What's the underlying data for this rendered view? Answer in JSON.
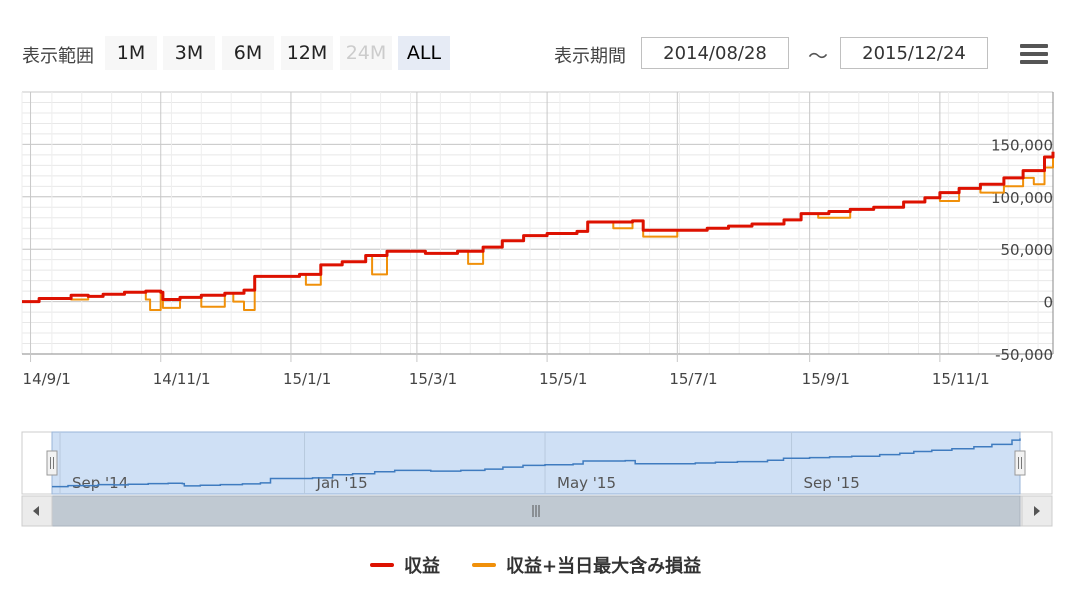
{
  "range_selector": {
    "label": "表示範囲",
    "buttons": [
      {
        "label": "1M",
        "state": "normal"
      },
      {
        "label": "3M",
        "state": "normal"
      },
      {
        "label": "6M",
        "state": "normal"
      },
      {
        "label": "12M",
        "state": "normal"
      },
      {
        "label": "24M",
        "state": "disabled"
      },
      {
        "label": "ALL",
        "state": "active"
      }
    ]
  },
  "date_range": {
    "label": "表示期間",
    "from": "2014/08/28",
    "separator": "～",
    "to": "2015/12/24"
  },
  "menu_icon": "hamburger-menu-icon",
  "colors": {
    "profit": "#dd1100",
    "profit_with_loss": "#f0900a",
    "navigator_fill": "#cfe0f5",
    "navigator_line": "#3f7bbf",
    "grid": "#dcdcdc"
  },
  "chart_data": {
    "type": "line",
    "title": "",
    "xlabel": "",
    "ylabel": "",
    "x_ticks": [
      "14/9/1",
      "14/11/1",
      "15/1/1",
      "15/3/1",
      "15/5/1",
      "15/7/1",
      "15/9/1",
      "15/11/1"
    ],
    "y_ticks": [
      "150,000",
      "100,000",
      "50,000",
      "0",
      "-50,000"
    ],
    "xlim": [
      "2014-08-28",
      "2015-12-24"
    ],
    "ylim": [
      -50000,
      200000
    ],
    "grid": true,
    "legend_position": "bottom",
    "series": [
      {
        "name": "収益",
        "color": "#dd1100",
        "points": [
          [
            "2014-08-28",
            0
          ],
          [
            "2014-09-05",
            3000
          ],
          [
            "2014-09-15",
            3000
          ],
          [
            "2014-09-20",
            6000
          ],
          [
            "2014-09-28",
            5000
          ],
          [
            "2014-10-05",
            7000
          ],
          [
            "2014-10-15",
            9000
          ],
          [
            "2014-10-25",
            10000
          ],
          [
            "2014-11-01",
            9000
          ],
          [
            "2014-11-02",
            2000
          ],
          [
            "2014-11-10",
            4000
          ],
          [
            "2014-11-20",
            6000
          ],
          [
            "2014-12-01",
            8000
          ],
          [
            "2014-12-10",
            11000
          ],
          [
            "2014-12-15",
            24000
          ],
          [
            "2014-12-25",
            24000
          ],
          [
            "2015-01-05",
            26000
          ],
          [
            "2015-01-15",
            35000
          ],
          [
            "2015-01-25",
            38000
          ],
          [
            "2015-02-05",
            44000
          ],
          [
            "2015-02-15",
            48000
          ],
          [
            "2015-02-25",
            48000
          ],
          [
            "2015-03-05",
            46000
          ],
          [
            "2015-03-20",
            48000
          ],
          [
            "2015-04-01",
            52000
          ],
          [
            "2015-04-10",
            58000
          ],
          [
            "2015-04-20",
            63000
          ],
          [
            "2015-05-01",
            65000
          ],
          [
            "2015-05-15",
            67000
          ],
          [
            "2015-05-20",
            76000
          ],
          [
            "2015-06-01",
            76000
          ],
          [
            "2015-06-10",
            77000
          ],
          [
            "2015-06-15",
            68000
          ],
          [
            "2015-07-01",
            68000
          ],
          [
            "2015-07-15",
            70000
          ],
          [
            "2015-07-25",
            72000
          ],
          [
            "2015-08-05",
            74000
          ],
          [
            "2015-08-20",
            78000
          ],
          [
            "2015-08-28",
            84000
          ],
          [
            "2015-09-10",
            86000
          ],
          [
            "2015-09-20",
            88000
          ],
          [
            "2015-10-01",
            90000
          ],
          [
            "2015-10-15",
            95000
          ],
          [
            "2015-10-25",
            99000
          ],
          [
            "2015-11-01",
            104000
          ],
          [
            "2015-11-10",
            108000
          ],
          [
            "2015-11-20",
            112000
          ],
          [
            "2015-12-01",
            118000
          ],
          [
            "2015-12-10",
            125000
          ],
          [
            "2015-12-20",
            138000
          ],
          [
            "2015-12-24",
            143000
          ]
        ]
      },
      {
        "name": "収益+当日最大含み損益",
        "color": "#f0900a",
        "points": [
          [
            "2014-08-28",
            0
          ],
          [
            "2014-09-05",
            3000
          ],
          [
            "2014-09-15",
            3000
          ],
          [
            "2014-09-20",
            2000
          ],
          [
            "2014-09-28",
            5000
          ],
          [
            "2014-10-05",
            7000
          ],
          [
            "2014-10-15",
            9000
          ],
          [
            "2014-10-25",
            2000
          ],
          [
            "2014-10-27",
            -8000
          ],
          [
            "2014-11-01",
            9000
          ],
          [
            "2014-11-02",
            -6000
          ],
          [
            "2014-11-10",
            4000
          ],
          [
            "2014-11-20",
            -5000
          ],
          [
            "2014-12-01",
            8000
          ],
          [
            "2014-12-05",
            0
          ],
          [
            "2014-12-10",
            -8000
          ],
          [
            "2014-12-15",
            24000
          ],
          [
            "2014-12-25",
            24000
          ],
          [
            "2015-01-05",
            26000
          ],
          [
            "2015-01-08",
            16000
          ],
          [
            "2015-01-15",
            35000
          ],
          [
            "2015-01-25",
            38000
          ],
          [
            "2015-02-05",
            44000
          ],
          [
            "2015-02-08",
            26000
          ],
          [
            "2015-02-15",
            48000
          ],
          [
            "2015-02-25",
            48000
          ],
          [
            "2015-03-05",
            46000
          ],
          [
            "2015-03-20",
            48000
          ],
          [
            "2015-03-25",
            36000
          ],
          [
            "2015-04-01",
            52000
          ],
          [
            "2015-04-10",
            58000
          ],
          [
            "2015-04-20",
            63000
          ],
          [
            "2015-05-01",
            65000
          ],
          [
            "2015-05-15",
            67000
          ],
          [
            "2015-05-20",
            76000
          ],
          [
            "2015-06-01",
            70000
          ],
          [
            "2015-06-10",
            77000
          ],
          [
            "2015-06-15",
            62000
          ],
          [
            "2015-07-01",
            68000
          ],
          [
            "2015-07-15",
            70000
          ],
          [
            "2015-07-25",
            72000
          ],
          [
            "2015-08-05",
            74000
          ],
          [
            "2015-08-20",
            78000
          ],
          [
            "2015-08-28",
            84000
          ],
          [
            "2015-09-05",
            80000
          ],
          [
            "2015-09-20",
            88000
          ],
          [
            "2015-10-01",
            90000
          ],
          [
            "2015-10-15",
            95000
          ],
          [
            "2015-10-25",
            99000
          ],
          [
            "2015-11-01",
            96000
          ],
          [
            "2015-11-10",
            108000
          ],
          [
            "2015-11-20",
            104000
          ],
          [
            "2015-12-01",
            110000
          ],
          [
            "2015-12-10",
            118000
          ],
          [
            "2015-12-15",
            112000
          ],
          [
            "2015-12-20",
            128000
          ],
          [
            "2015-12-24",
            143000
          ]
        ]
      }
    ],
    "navigator": {
      "x_labels": [
        "Sep '14",
        "Jan '15",
        "May '15",
        "Sep '15"
      ]
    }
  }
}
